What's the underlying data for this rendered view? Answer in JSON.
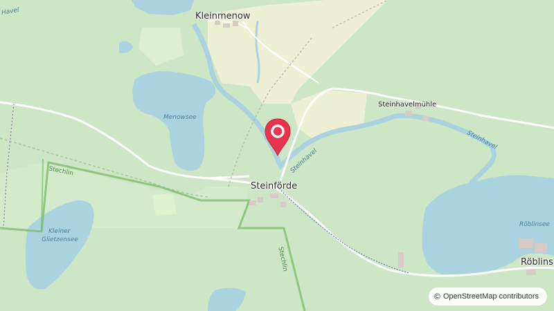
{
  "map": {
    "places": {
      "kleinmenow": "Kleinmenow",
      "steinhavelmuhle": "Steinhavelmühle",
      "steinforde": "Steinförde",
      "roblinsee_town": "Röblins"
    },
    "water": {
      "havel": "Havel",
      "menowsee": "Menowsee",
      "steinhavel_1": "Steinhavel",
      "steinhavel_2": "Steinhavel",
      "roblinsee": "Röblinsee",
      "kleiner_glietzensee_1": "Kleiner",
      "kleiner_glietzensee_2": "Glietzensee"
    },
    "borders": {
      "stechlin_1": "Stechlin",
      "stechlin_2": "Stechlin"
    },
    "colors": {
      "forest": "#cde6c6",
      "water": "#aad3df",
      "farmland": "#eef0d5",
      "marker": "#e8344e",
      "border": "#7fba6c"
    },
    "marker_icon": "location-pin-icon",
    "attribution": {
      "symbol": "©",
      "text": "OpenStreetMap contributors"
    }
  }
}
